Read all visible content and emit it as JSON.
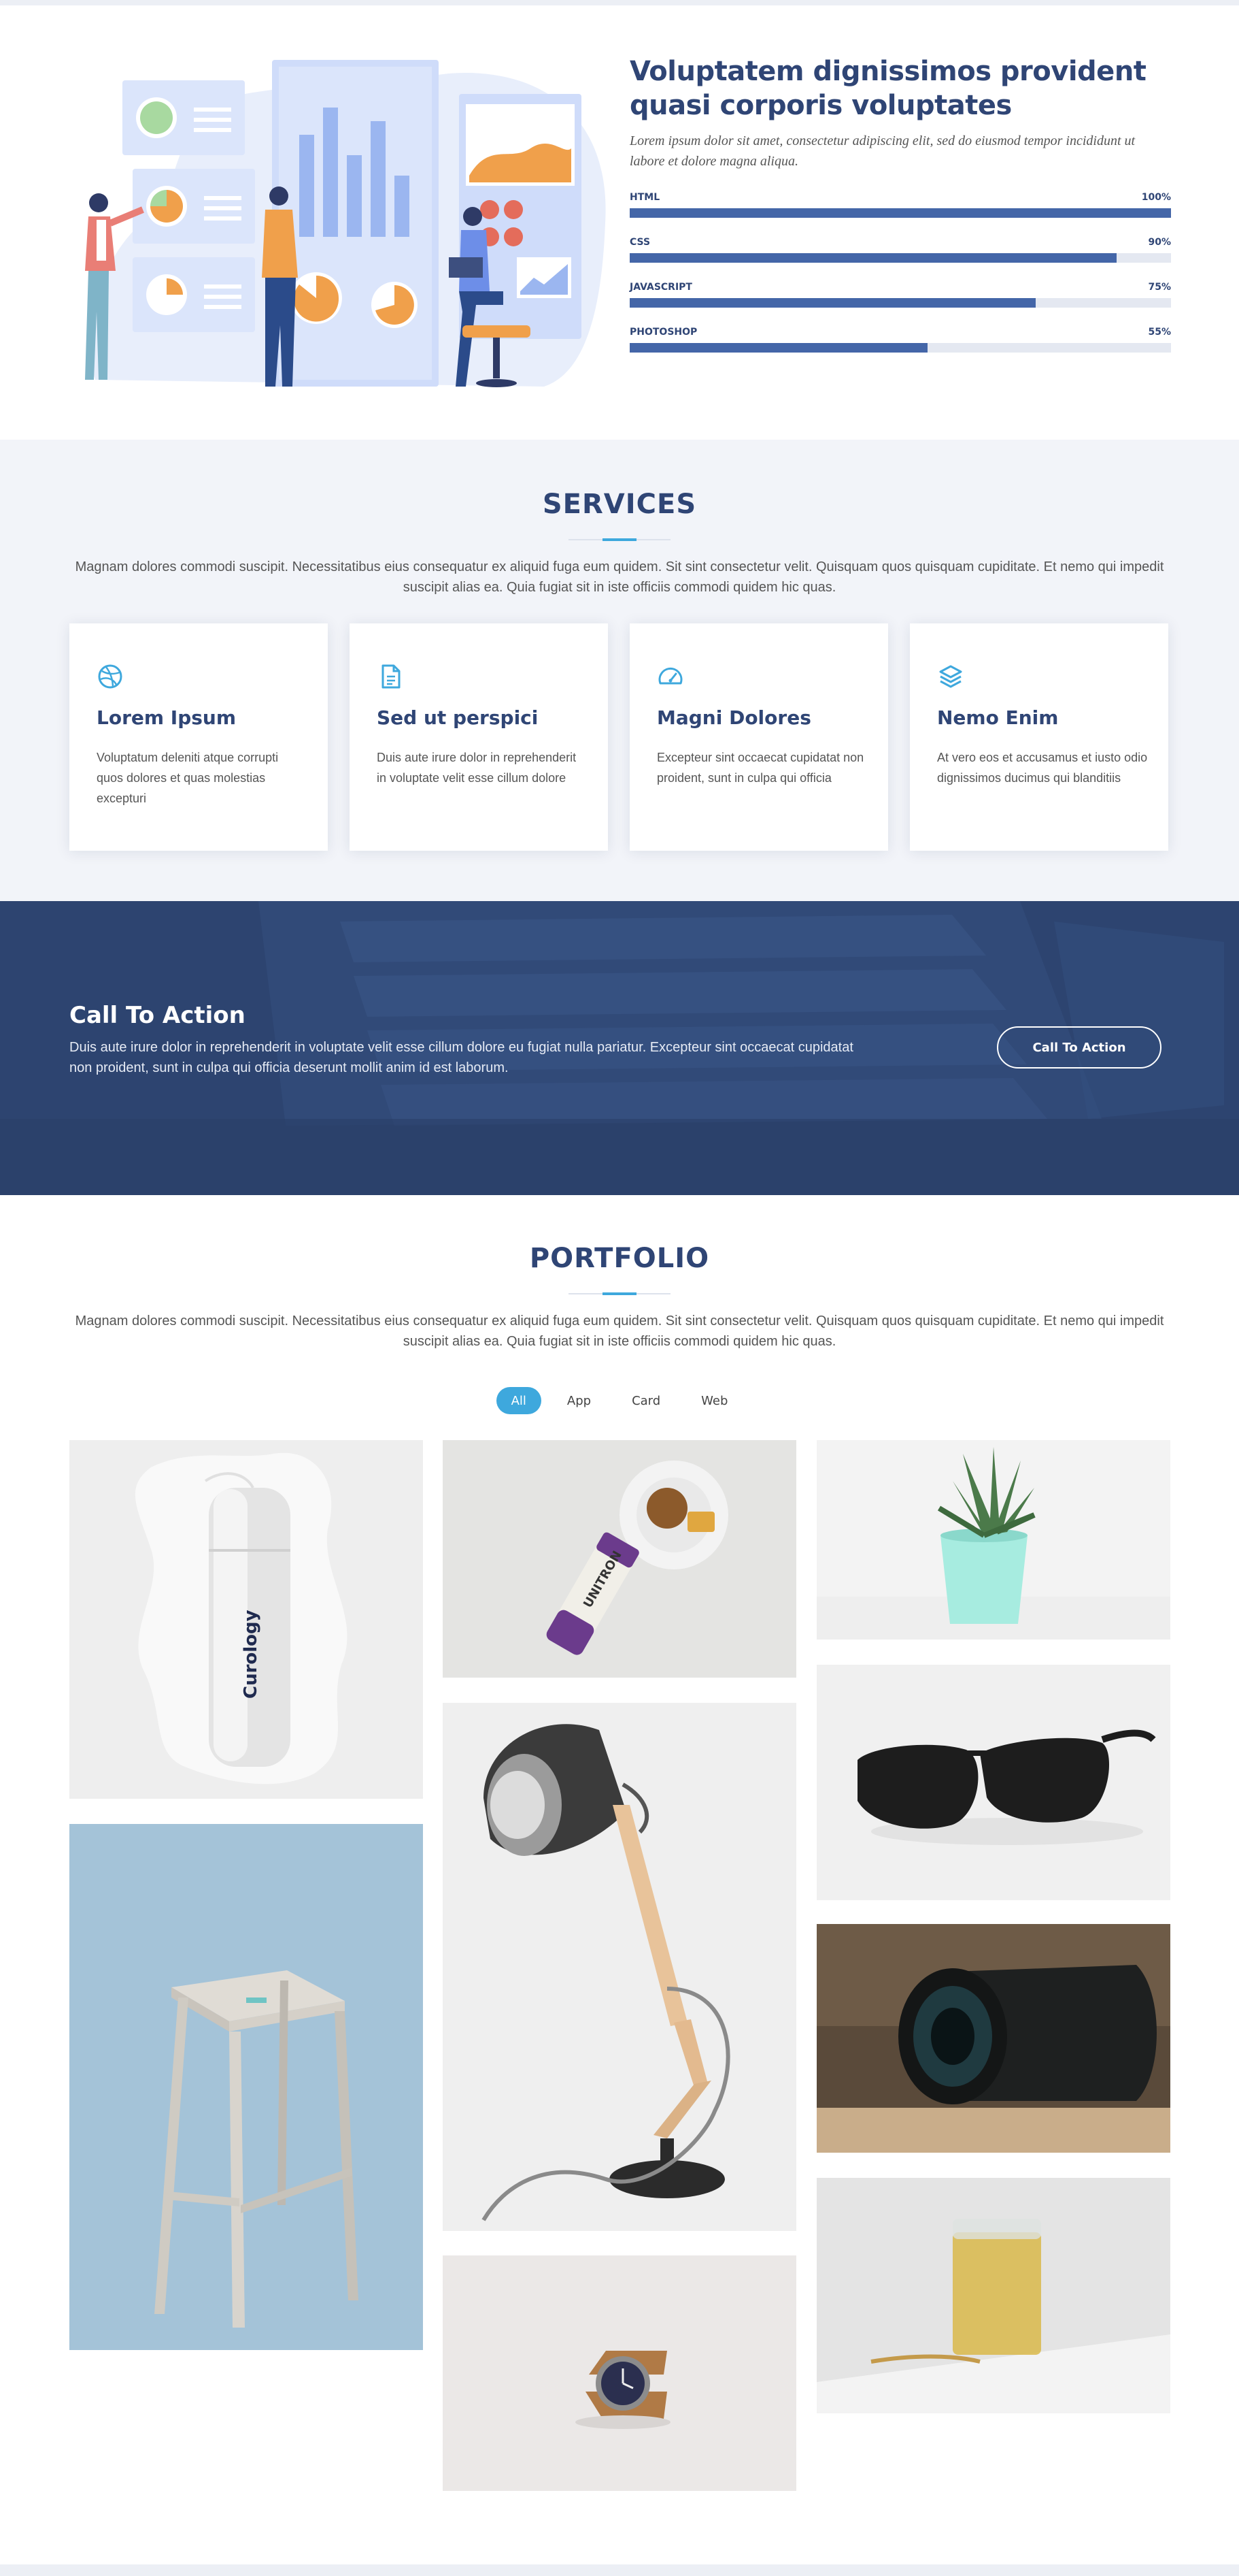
{
  "skills": {
    "title": "Voluptatem dignissimos provident quasi corporis voluptates",
    "description": "Lorem ipsum dolor sit amet, consectetur adipiscing elit, sed do eiusmod tempor incididunt ut labore et dolore magna aliqua.",
    "items": [
      {
        "name": "HTML",
        "percent_label": "100%",
        "value": 1.0
      },
      {
        "name": "CSS",
        "percent_label": "90%",
        "value": 0.9
      },
      {
        "name": "JAVASCRIPT",
        "percent_label": "75%",
        "value": 0.75
      },
      {
        "name": "PHOTOSHOP",
        "percent_label": "55%",
        "value": 0.55
      }
    ]
  },
  "services": {
    "title": "SERVICES",
    "description": "Magnam dolores commodi suscipit. Necessitatibus eius consequatur ex aliquid fuga eum quidem. Sit sint consectetur velit. Quisquam quos quisquam cupiditate. Et nemo qui impedit suscipit alias ea. Quia fugiat sit in iste officiis commodi quidem hic quas.",
    "cards": [
      {
        "icon": "dribbble-icon",
        "title": "Lorem Ipsum",
        "text": "Voluptatum deleniti atque corrupti quos dolores et quas molestias excepturi"
      },
      {
        "icon": "file-icon",
        "title": "Sed ut perspici",
        "text": "Duis aute irure dolor in reprehenderit in voluptate velit esse cillum dolore"
      },
      {
        "icon": "speedometer-icon",
        "title": "Magni Dolores",
        "text": "Excepteur sint occaecat cupidatat non proident, sunt in culpa qui officia"
      },
      {
        "icon": "layers-icon",
        "title": "Nemo Enim",
        "text": "At vero eos et accusamus et iusto odio dignissimos ducimus qui blanditiis"
      }
    ]
  },
  "cta": {
    "title": "Call To Action",
    "description": "Duis aute irure dolor in reprehenderit in voluptate velit esse cillum dolore eu fugiat nulla pariatur. Excepteur sint occaecat cupidatat non proident, sunt in culpa qui officia deserunt mollit anim id est laborum.",
    "button": "Call To Action"
  },
  "portfolio": {
    "title": "PORTFOLIO",
    "description": "Magnam dolores commodi suscipit. Necessitatibus eius consequatur ex aliquid fuga eum quidem. Sit sint consectetur velit. Quisquam quos quisquam cupiditate. Et nemo qui impedit suscipit alias ea. Quia fugiat sit in iste officiis commodi quidem hic quas.",
    "filters": [
      "All",
      "App",
      "Card",
      "Web"
    ],
    "active_filter": "All",
    "bottle_brand": "Curology",
    "can_label": "UNITRON"
  },
  "colors": {
    "heading": "#2f4575",
    "accent": "#3ea8dd",
    "skill_bar": "#4466a8",
    "cta_bg": "#2d4470"
  }
}
